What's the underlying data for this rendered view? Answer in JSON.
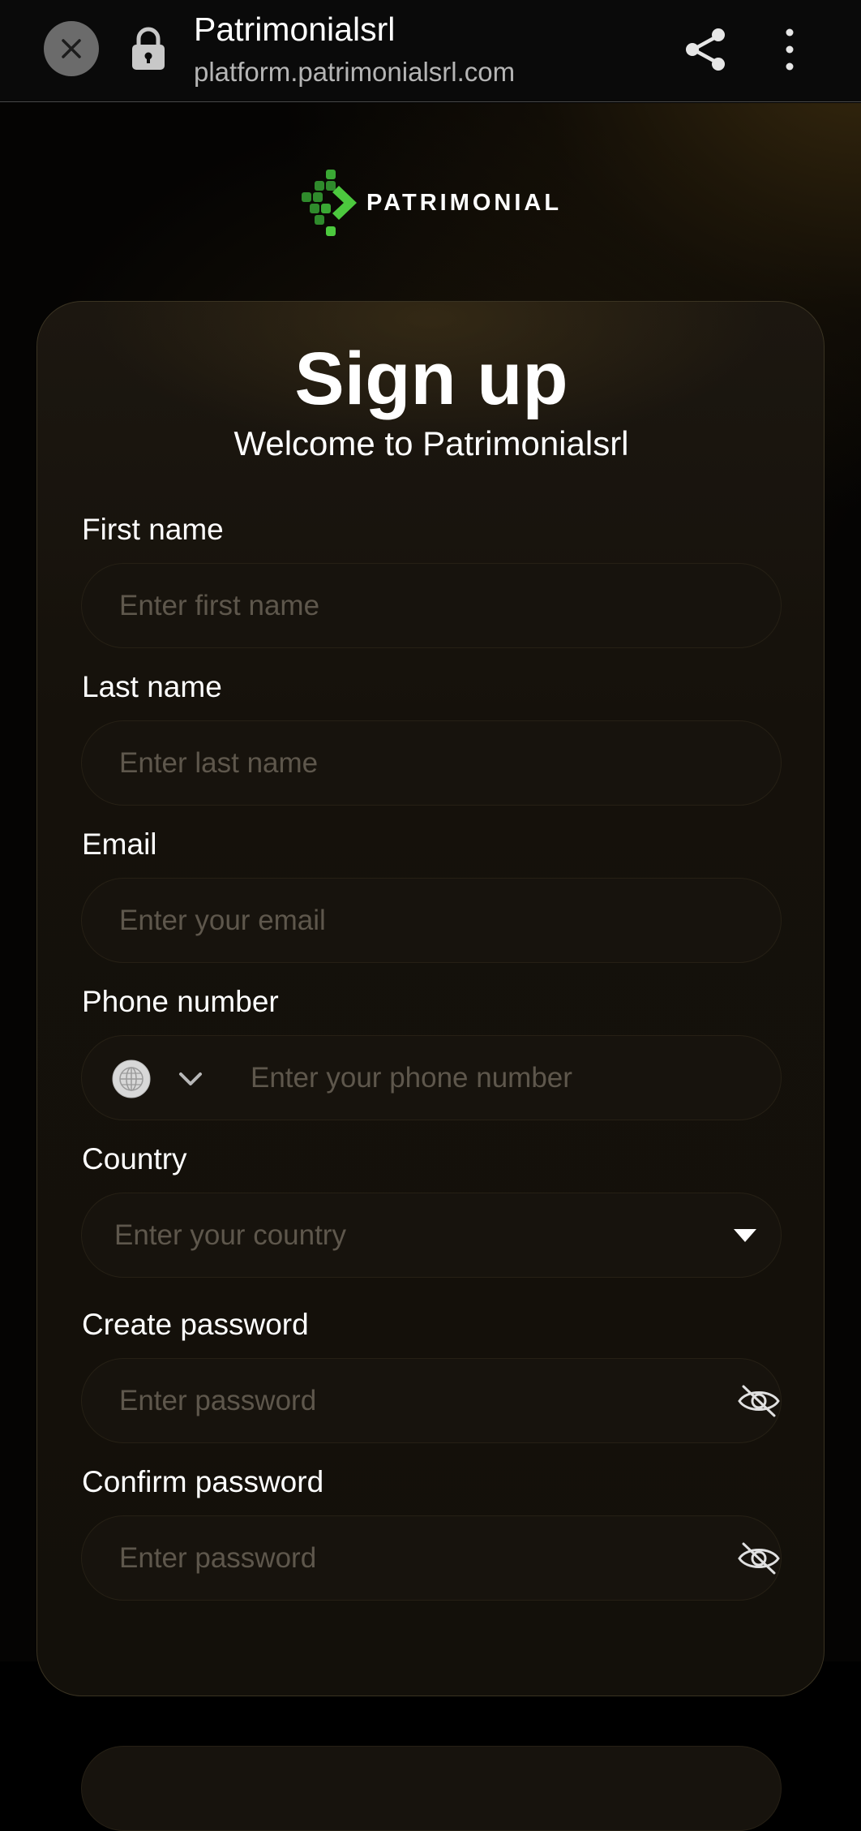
{
  "browser": {
    "site_title": "Patrimonialsrl",
    "site_url": "platform.patrimonialsrl.com",
    "icons": [
      "close-icon",
      "lock-icon",
      "share-icon",
      "more-vertical-icon"
    ]
  },
  "logo": {
    "text": "PATRIMONIAL",
    "mark_colors": [
      "#2f8a2c",
      "#4cc93e",
      "#3aa834"
    ]
  },
  "form": {
    "title": "Sign up",
    "subtitle": "Welcome to Patrimonialsrl",
    "first_name": {
      "label": "First name",
      "placeholder": "Enter first name",
      "value": ""
    },
    "last_name": {
      "label": "Last name",
      "placeholder": "Enter last name",
      "value": ""
    },
    "email": {
      "label": "Email",
      "placeholder": "Enter your email",
      "value": ""
    },
    "phone": {
      "label": "Phone number",
      "placeholder": "Enter your phone number",
      "value": "",
      "icons": [
        "globe-icon",
        "chevron-down-icon"
      ]
    },
    "country": {
      "label": "Country",
      "placeholder": "Enter your country",
      "icon": "caret-down-icon"
    },
    "create_password": {
      "label": "Create password",
      "placeholder": "Enter password",
      "value": "",
      "icon": "eye-off-icon"
    },
    "confirm_password": {
      "label": "Confirm password",
      "placeholder": "Enter password",
      "value": "",
      "icon": "eye-off-icon"
    }
  },
  "colors": {
    "background": "#050403",
    "card": "#15110b",
    "field": "#17130d",
    "placeholder": "#5e574c",
    "accent_green": "#4cc93e"
  }
}
